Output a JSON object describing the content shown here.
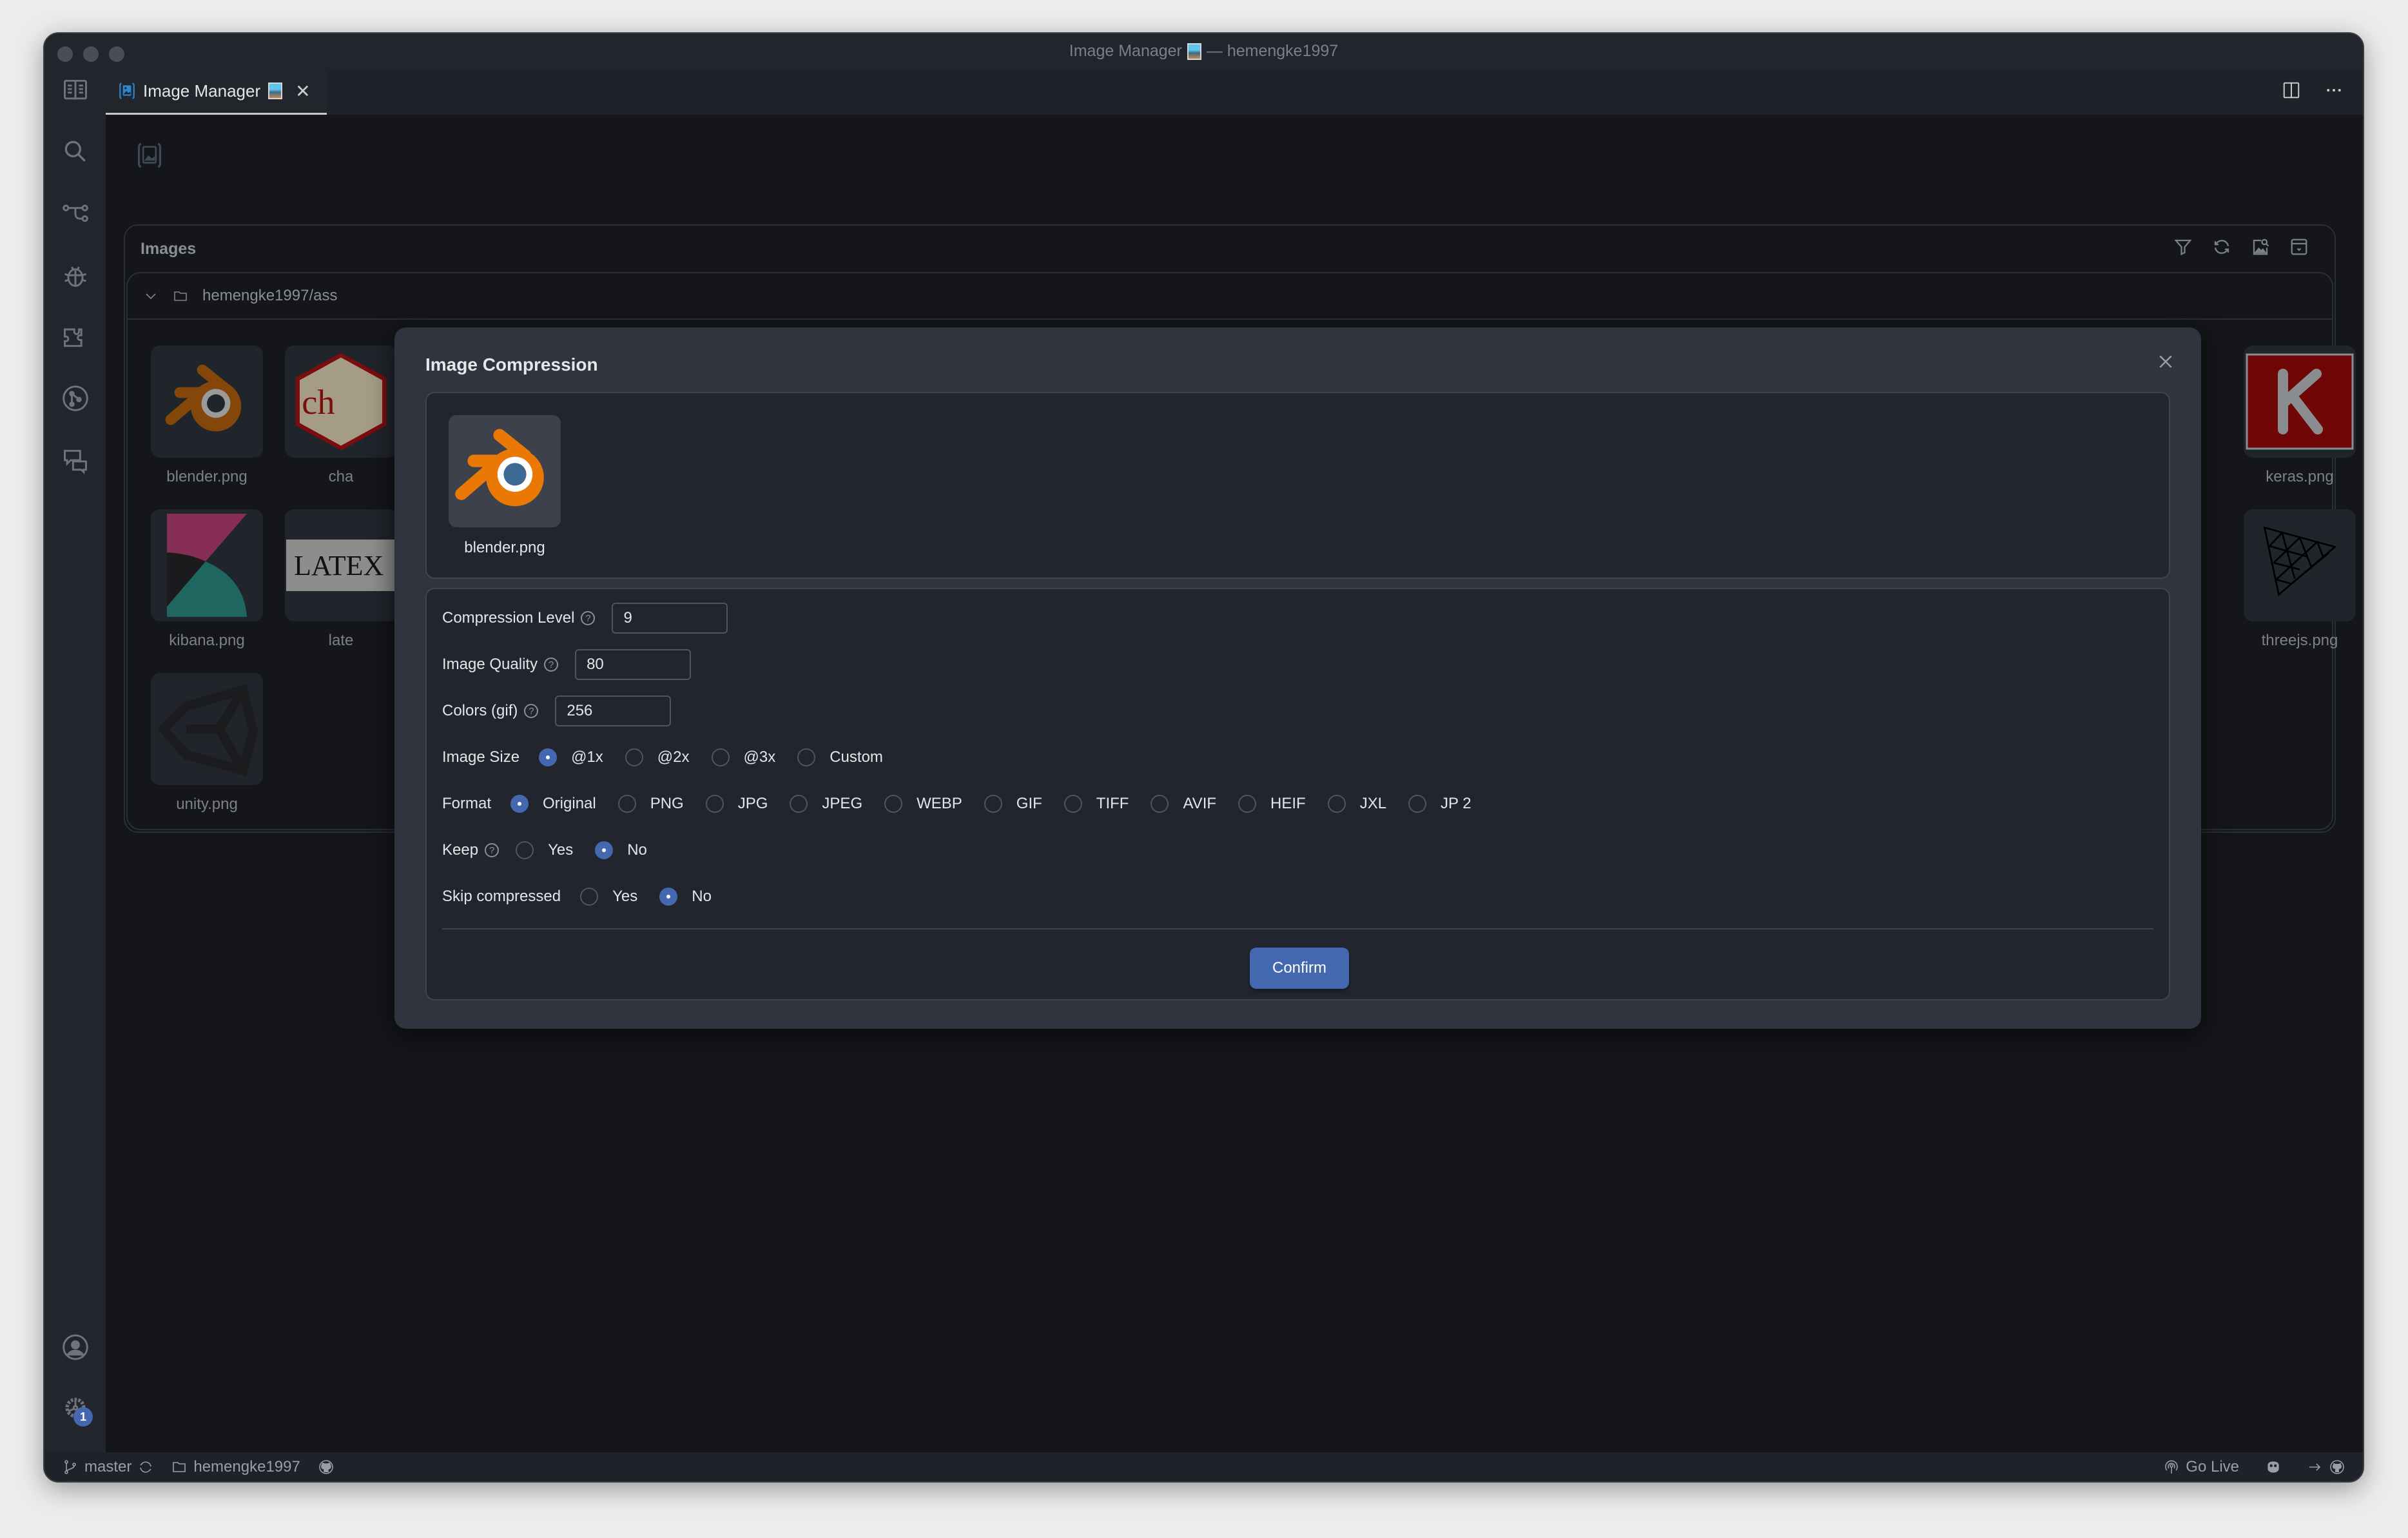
{
  "window": {
    "title": "Image Manager",
    "title_suffix": "— hemengke1997"
  },
  "tabs": [
    {
      "label": "Image Manager",
      "active": true
    }
  ],
  "activity_bar": {
    "items": [
      "explorer-icon",
      "search-icon",
      "source-control-icon",
      "debug-icon",
      "extensions-icon",
      "git-graph-icon",
      "comments-icon"
    ],
    "bottom": [
      "account-icon",
      "settings-icon"
    ],
    "settings_badge": "1"
  },
  "images_panel": {
    "title": "Images",
    "tools": [
      "filter-icon",
      "refresh-icon",
      "image-search-icon",
      "collapse-icon"
    ],
    "folder": "hemengke1997/ass",
    "images": [
      {
        "name": "blender.png"
      },
      {
        "name": "cha"
      },
      {
        "name": "kibana.png"
      },
      {
        "name": "late"
      },
      {
        "name": "unity.png"
      },
      {
        "name": "keras.png"
      },
      {
        "name": "threejs.png"
      }
    ]
  },
  "modal": {
    "title": "Image Compression",
    "preview": {
      "name": "blender.png"
    },
    "fields": {
      "compression_level": {
        "label": "Compression Level",
        "value": "9"
      },
      "image_quality": {
        "label": "Image Quality",
        "value": "80"
      },
      "colors": {
        "label": "Colors (gif)",
        "value": "256"
      }
    },
    "image_size": {
      "label": "Image Size",
      "options": [
        "@1x",
        "@2x",
        "@3x",
        "Custom"
      ],
      "selected": "@1x"
    },
    "format": {
      "label": "Format",
      "options": [
        "Original",
        "PNG",
        "JPG",
        "JPEG",
        "WEBP",
        "GIF",
        "TIFF",
        "AVIF",
        "HEIF",
        "JXL",
        "JP 2"
      ],
      "selected": "Original"
    },
    "keep": {
      "label": "Keep",
      "options": [
        "Yes",
        "No"
      ],
      "selected": "No"
    },
    "skip_compressed": {
      "label": "Skip compressed",
      "options": [
        "Yes",
        "No"
      ],
      "selected": "No"
    },
    "confirm_label": "Confirm"
  },
  "status_bar": {
    "branch": "master",
    "folder": "hemengke1997",
    "go_live": "Go Live"
  },
  "colors": {
    "accent": "#4468b0",
    "modal_bg": "#30343f",
    "panel_bg": "#22252d"
  }
}
